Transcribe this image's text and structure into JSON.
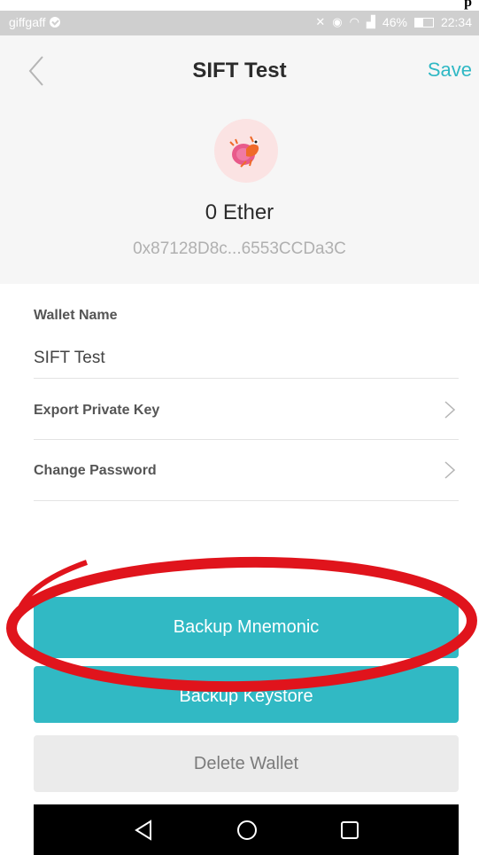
{
  "stray_mark": "p",
  "status_bar": {
    "carrier": "giffgaff",
    "battery": "46%",
    "battery_level": 0.46,
    "time": "22:34",
    "icons": [
      "mute-icon",
      "eye-icon",
      "wifi-icon",
      "signal-icon",
      "battery-icon"
    ]
  },
  "header": {
    "back_icon": "chevron-left-icon",
    "title": "SIFT Test",
    "save_label": "Save"
  },
  "wallet": {
    "avatar": "hermit-crab-avatar",
    "balance": "0 Ether",
    "address": "0x87128D8c...6553CCDa3C"
  },
  "form": {
    "wallet_name_label": "Wallet Name",
    "wallet_name_value": "SIFT Test",
    "export_private_key": "Export Private Key",
    "change_password": "Change Password"
  },
  "buttons": {
    "backup_mnemonic": "Backup Mnemonic",
    "backup_keystore": "Backup Keystore",
    "delete_wallet": "Delete Wallet"
  },
  "colors": {
    "accent": "#31b9c4",
    "highlight_annotation": "#e0141c"
  },
  "nav_bar": {
    "back": "triangle-back-icon",
    "home": "circle-home-icon",
    "recents": "square-recents-icon"
  }
}
